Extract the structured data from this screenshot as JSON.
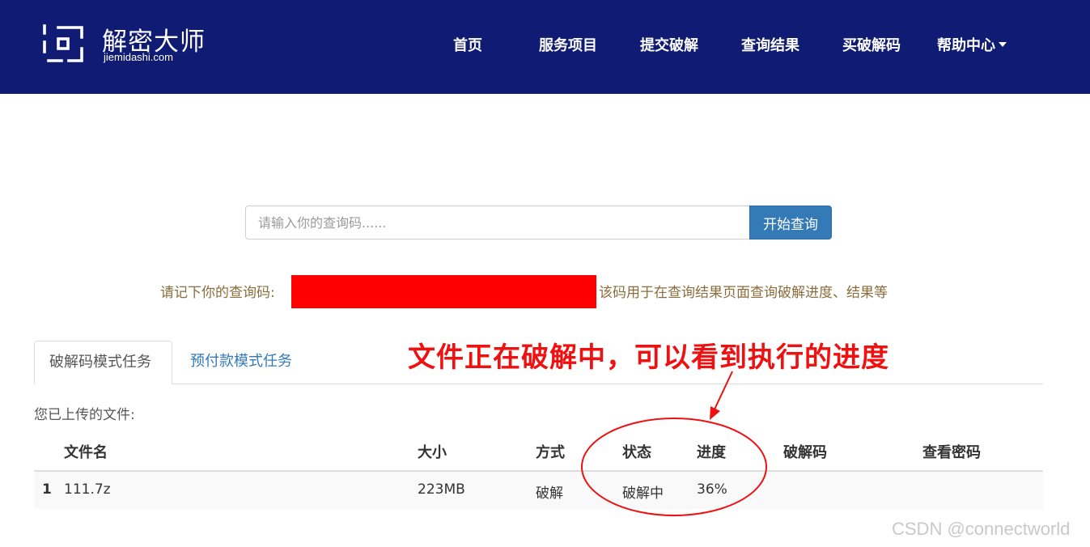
{
  "header": {
    "logo": {
      "title": "解密大师",
      "subtitle": "jiemidashi.com"
    },
    "nav": [
      {
        "label": "首页"
      },
      {
        "label": "服务项目"
      },
      {
        "label": "提交破解"
      },
      {
        "label": "查询结果"
      },
      {
        "label": "买破解码"
      },
      {
        "label": "帮助中心",
        "dropdown": true
      }
    ],
    "background_color": "#101c73"
  },
  "search": {
    "placeholder": "请输入你的查询码......",
    "value": "",
    "button_label": "开始查询",
    "button_color": "#337ab7"
  },
  "code_notice": {
    "label": "请记下你的查询码:",
    "redaction_color": "#ff0000",
    "note": "该码用于在查询结果页面查询破解进度、结果等"
  },
  "tabs": [
    {
      "label": "破解码模式任务",
      "active": true
    },
    {
      "label": "预付款模式任务",
      "active": false
    }
  ],
  "annotation": {
    "text": "文件正在破解中，可以看到执行的进度",
    "color": "#ee1111"
  },
  "files": {
    "label": "您已上传的文件:",
    "columns": [
      "文件名",
      "大小",
      "方式",
      "状态",
      "进度",
      "破解码",
      "查看密码"
    ],
    "rows": [
      {
        "index": "1",
        "name": "111.7z",
        "size": "223MB",
        "mode": "破解",
        "status": "破解中",
        "progress": "36%",
        "crack_code": "",
        "view_password": ""
      }
    ]
  },
  "watermark": "CSDN @connectworld"
}
